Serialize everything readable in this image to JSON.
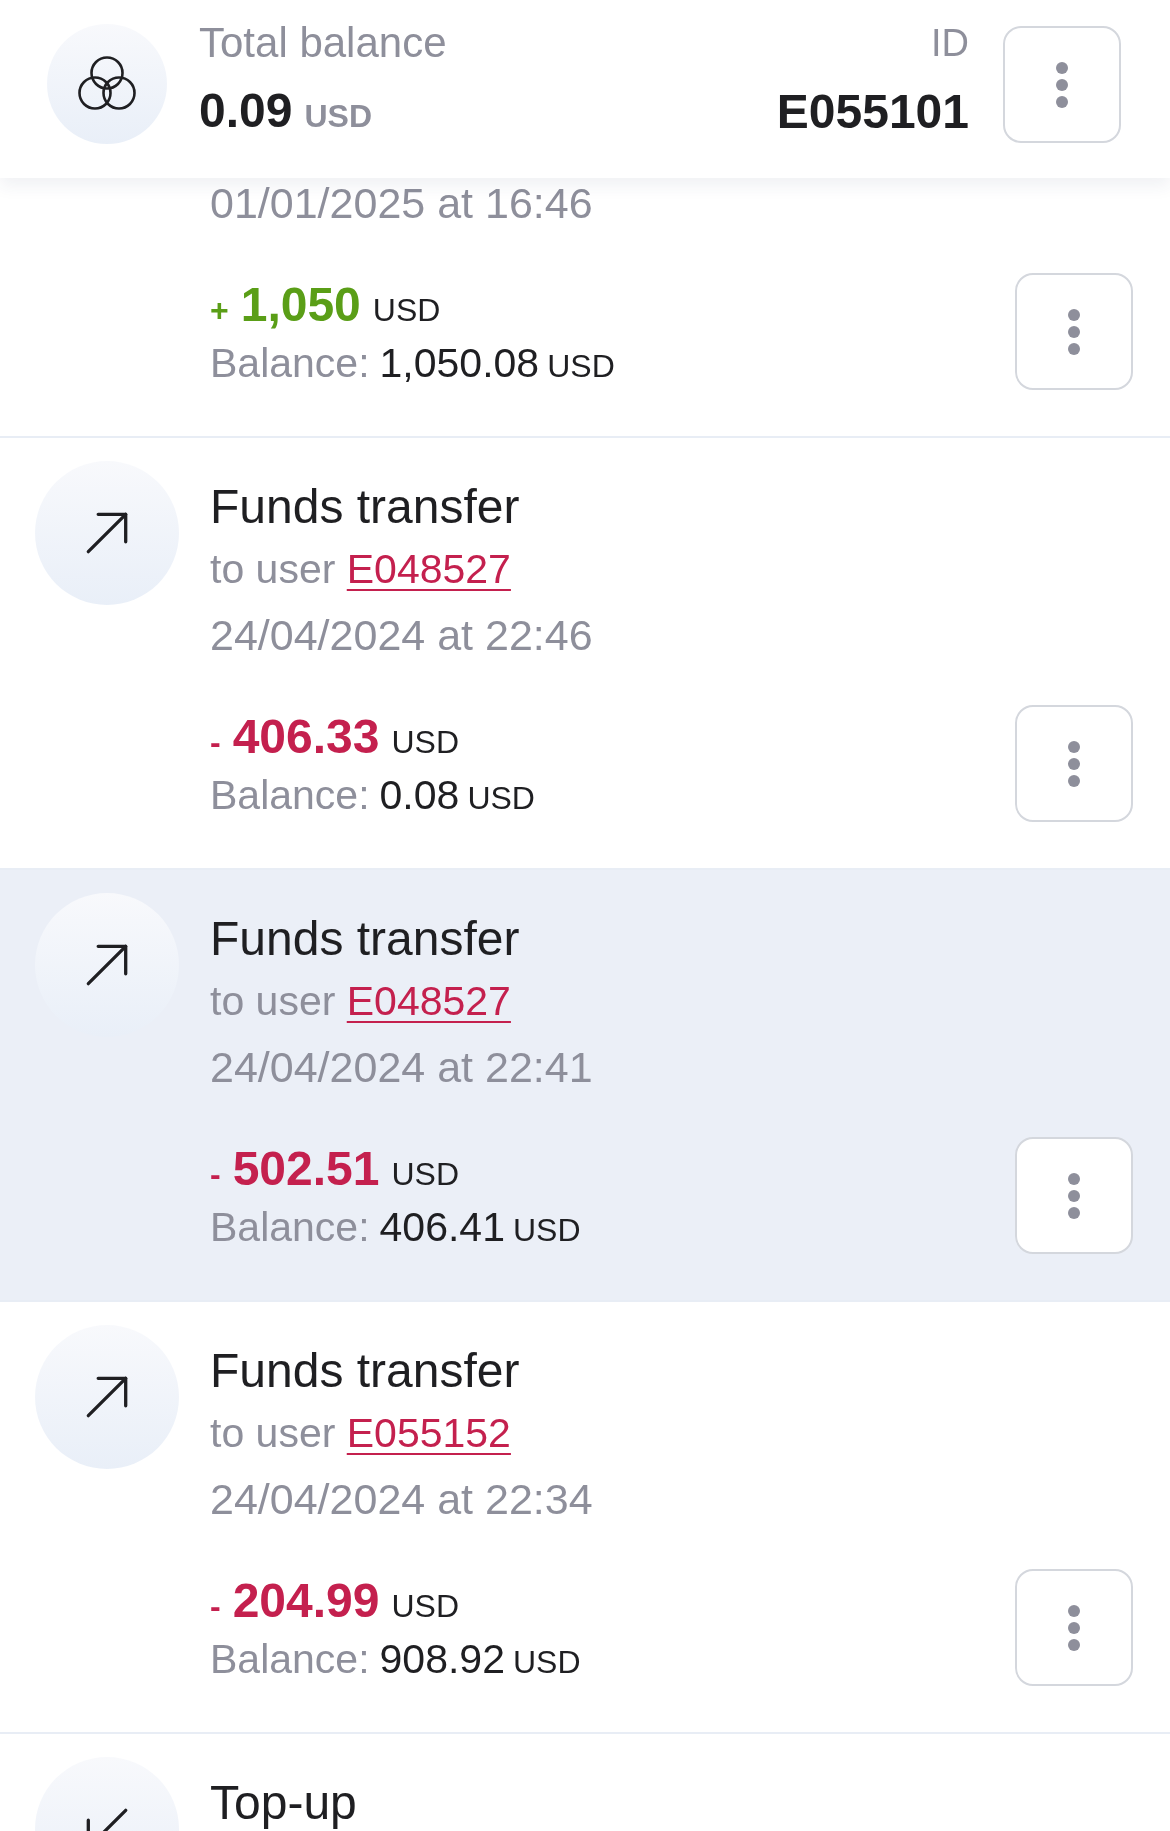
{
  "header": {
    "balance_label": "Total balance",
    "balance": "0.09",
    "balance_currency": "USD",
    "id_label": "ID",
    "id": "E055101"
  },
  "transactions": [
    {
      "kind": "incoming",
      "selected": false,
      "date": "01/01/2025 at 16:46",
      "sign": "+",
      "amount": "1,050",
      "currency": "USD",
      "balance_label": "Balance:",
      "balance": "1,050.08",
      "balance_currency": "USD"
    },
    {
      "kind": "outgoing",
      "selected": false,
      "title": "Funds transfer",
      "recipient_prefix": "to user",
      "recipient": "E048527",
      "date": "24/04/2024 at 22:46",
      "sign": "-",
      "amount": "406.33",
      "currency": "USD",
      "balance_label": "Balance:",
      "balance": "0.08",
      "balance_currency": "USD"
    },
    {
      "kind": "outgoing",
      "selected": true,
      "title": "Funds transfer",
      "recipient_prefix": "to user",
      "recipient": "E048527",
      "date": "24/04/2024 at 22:41",
      "sign": "-",
      "amount": "502.51",
      "currency": "USD",
      "balance_label": "Balance:",
      "balance": "406.41",
      "balance_currency": "USD"
    },
    {
      "kind": "outgoing",
      "selected": false,
      "title": "Funds transfer",
      "recipient_prefix": "to user",
      "recipient": "E055152",
      "date": "24/04/2024 at 22:34",
      "sign": "-",
      "amount": "204.99",
      "currency": "USD",
      "balance_label": "Balance:",
      "balance": "908.92",
      "balance_currency": "USD"
    },
    {
      "kind": "incoming",
      "selected": false,
      "title": "Top-up"
    }
  ]
}
